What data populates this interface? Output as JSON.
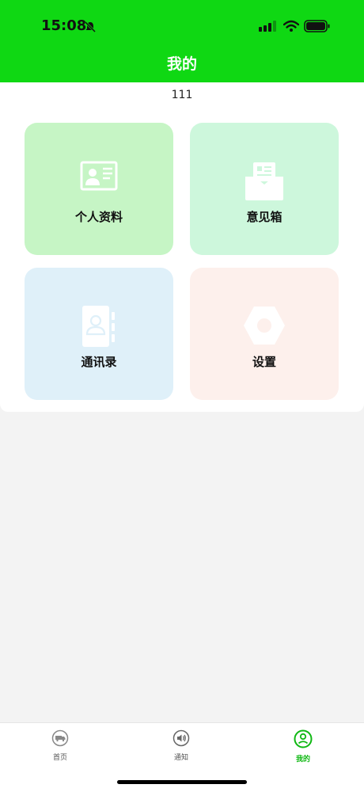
{
  "status_bar": {
    "time": "15:08"
  },
  "header": {
    "title": "我的"
  },
  "user": {
    "name": "111"
  },
  "menu": [
    {
      "label": "个人资料",
      "icon": "id-card-icon",
      "bg": "#c6f5c5"
    },
    {
      "label": "意见箱",
      "icon": "mailbox-icon",
      "bg": "#cdf7dc"
    },
    {
      "label": "通讯录",
      "icon": "contacts-book-icon",
      "bg": "#dff0f9"
    },
    {
      "label": "设置",
      "icon": "hex-nut-icon",
      "bg": "#fdf0ec"
    }
  ],
  "tabs": [
    {
      "label": "首页",
      "icon": "truck-icon",
      "active": false
    },
    {
      "label": "通知",
      "icon": "speaker-icon",
      "active": false
    },
    {
      "label": "我的",
      "icon": "user-icon",
      "active": true
    }
  ],
  "colors": {
    "primary": "#0fd813",
    "active_tab": "#0fb813"
  }
}
